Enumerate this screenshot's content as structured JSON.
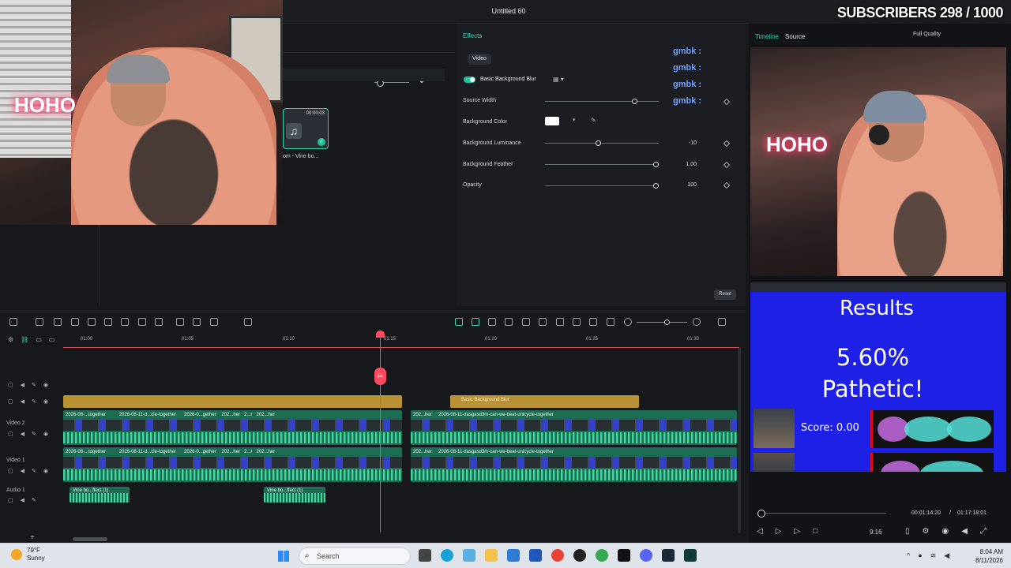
{
  "window": {
    "title": "Untitled 60",
    "overlay_subscribers": "SUBSCRIBERS 298 / 1000"
  },
  "media": {
    "clip_duration": "00:00:03",
    "clip_name": "om - Vine bo..."
  },
  "effects": {
    "header": "Effects",
    "tab_video": "Video",
    "effect_name": "Basic Background Blur",
    "props": [
      {
        "label": "Source Width",
        "value": "",
        "level": 0.8
      },
      {
        "label": "Background Color",
        "value": ""
      },
      {
        "label": "Background Luminance",
        "value": "-10",
        "level": 0.47
      },
      {
        "label": "Background Feather",
        "value": "1.00",
        "level": 1.0
      },
      {
        "label": "Opacity",
        "value": "100",
        "level": 1.0
      }
    ],
    "reset": "Reset",
    "gmbk": [
      "gmbk :",
      "gmbk :",
      "gmbk :",
      "gmbk :"
    ]
  },
  "preview": {
    "tab_timeline": "Timeline",
    "tab_source": "Source",
    "quality": "Full Quality",
    "results_title": "Results",
    "results_pct": "5.60%",
    "results_verdict": "Pathetic!",
    "score": "Score: 0.00",
    "timecode_current": "00:01:14:20",
    "timecode_sep": "/",
    "timecode_total": "01:17:18:01",
    "ratio": "9:16",
    "accent": "#39d3b0",
    "results_bg": "#1f20e6"
  },
  "timeline": {
    "ruler": [
      "01:00",
      "01:05",
      "01:10",
      "01:15",
      "01:20",
      "01:25",
      "01:30"
    ],
    "tracks": [
      "Video 2",
      "Video 1",
      "Audio 1"
    ],
    "effect_clip": "Basic Background Blur",
    "v2_labels": [
      "2026-08-...together",
      "2026-08-11-d...cle-together",
      "2026-0...gether",
      "202...her",
      "2...r",
      "202...her",
      "202...her",
      "2026-08-11-dasgasd3m-can-we-beat-unicycle-together"
    ],
    "v1_labels": [
      "2026-08-...together",
      "2026-08-11-d...cle-together",
      "2026-0...gether",
      "202...her",
      "2...r",
      "202...her",
      "202...her",
      "2026-08-11-dasgasd3m-can-we-beat-unicycle-together"
    ],
    "a1_labels": [
      "Vine bo...ffect (1)",
      "Vine bo...ffect (1)"
    ],
    "playhead_color": "#ff4a5f"
  },
  "taskbar": {
    "temp": "79°F",
    "condition": "Sunny",
    "search": "Search",
    "time": "8:04 AM",
    "date": "8/11/2026"
  }
}
